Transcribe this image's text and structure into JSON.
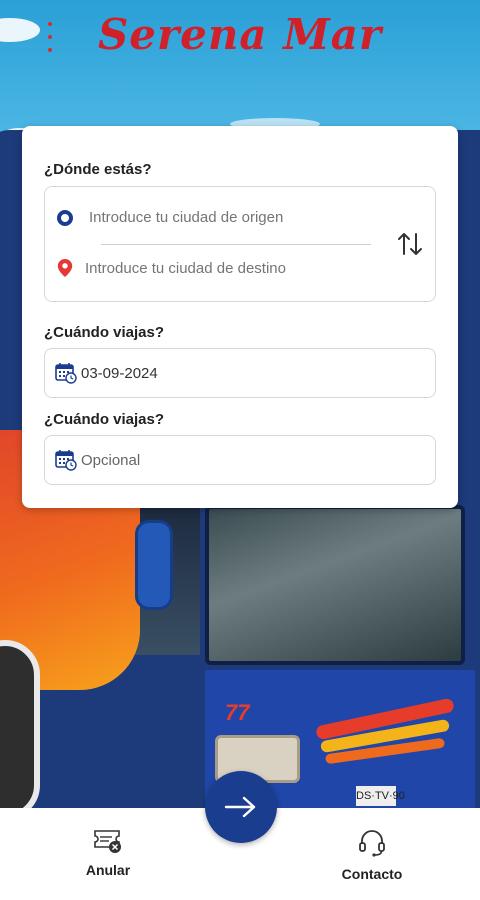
{
  "header": {
    "brand": "Serena Mar",
    "menu_icon": "more-vert-icon"
  },
  "search_form": {
    "origin_section_label": "¿Dónde estás?",
    "origin_placeholder": "Introduce tu ciudad de origen",
    "destination_placeholder": "Introduce tu ciudad de destino",
    "departure_section_label": "¿Cuándo viajas?",
    "departure_date": "03-09-2024",
    "return_section_label": "¿Cuándo viajas?",
    "return_placeholder": "Opcional"
  },
  "bottom_nav": {
    "cancel_label": "Anular",
    "contact_label": "Contacto",
    "search_icon": "arrow-right-icon"
  },
  "colors": {
    "brand_red": "#d0202a",
    "primary_blue": "#1b3d8f",
    "pin_red": "#e53935"
  }
}
